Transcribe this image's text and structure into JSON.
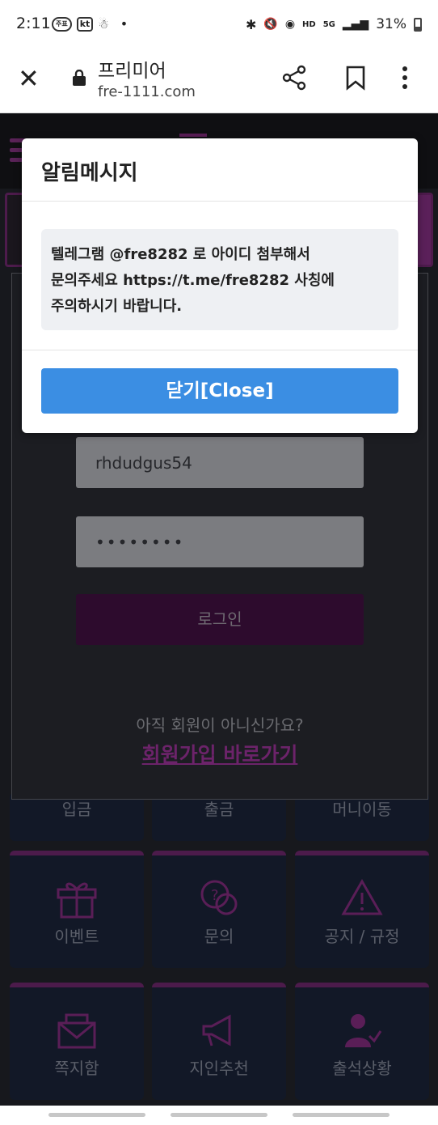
{
  "status_bar": {
    "time": "2:11",
    "left_icons": [
      "notification-badge",
      "kt",
      "icon",
      "dot"
    ],
    "left_kt": "kt",
    "left_badge": "주표",
    "battery": "31%",
    "right_labels": {
      "hd": "HD",
      "g5": "5G"
    }
  },
  "browser": {
    "title": "프리미어",
    "url": "fre-1111.com"
  },
  "modal": {
    "title": "알림메시지",
    "message_lines": [
      "텔레그램 @fre8282 로 아이디 첨부해서",
      "문의주세요 https://t.me/fre8282 사칭에",
      "주의하시기 바랍니다."
    ],
    "close_label": "닫기[Close]"
  },
  "login": {
    "username_value": "rhdudgus54",
    "password_value": "••••••••",
    "login_label": "로그인",
    "not_member_text": "아직 회원이 아니신가요?",
    "signup_link": "회원가입 바로가기"
  },
  "tiles": {
    "row1": [
      "입금",
      "출금",
      "머니이동"
    ],
    "row2": [
      "이벤트",
      "문의",
      "공지 / 규정"
    ],
    "row3": [
      "쪽지함",
      "지인추천",
      "출석상황"
    ]
  },
  "colors": {
    "accent_blue": "#3b8ee3",
    "brand_pink": "#5a1e57",
    "modal_bg": "#ffffff"
  }
}
